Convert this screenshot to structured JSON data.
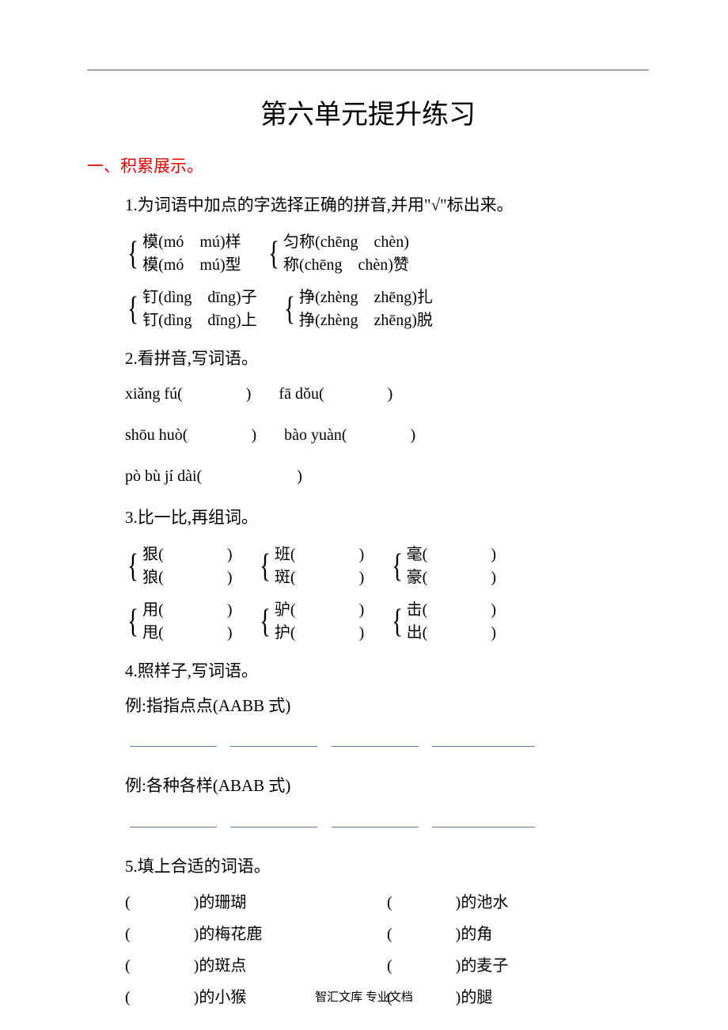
{
  "title": "第六单元提升练习",
  "section1": {
    "head": "一、积累展示。",
    "q1": {
      "prompt": "1.为词语中加点的字选择正确的拼音,并用\"√\"标出来。",
      "groups": [
        {
          "a": "模(mó　mú)样",
          "b": "模(mó　mú)型"
        },
        {
          "a": "匀称(chēng　chèn)",
          "b": "称(chēng　chèn)赞"
        },
        {
          "a": "钉(dìng　dīng)子",
          "b": "钉(dìng　dīng)上"
        },
        {
          "a": "挣(zhèng　zhēng)扎",
          "b": "挣(zhèng　zhēng)脱"
        }
      ]
    },
    "q2": {
      "prompt": "2.看拼音,写词语。",
      "items": [
        "xiǎng fú(　　　　)",
        "fā dǒu(　　　　)",
        "shōu huò(　　　　)",
        "bào yuàn(　　　　)",
        "pò bù jí dài(　　　　　　)"
      ]
    },
    "q3": {
      "prompt": "3.比一比,再组词。",
      "groups": [
        {
          "a": "狠(　　　　)",
          "b": "狼(　　　　)"
        },
        {
          "a": "班(　　　　)",
          "b": "斑(　　　　)"
        },
        {
          "a": "毫(　　　　)",
          "b": "豪(　　　　)"
        },
        {
          "a": "用(　　　　)",
          "b": "甩(　　　　)"
        },
        {
          "a": "驴(　　　　)",
          "b": "护(　　　　)"
        },
        {
          "a": "击(　　　　)",
          "b": "出(　　　　)"
        }
      ]
    },
    "q4": {
      "prompt": "4.照样子,写词语。",
      "ex1": "例:指指点点(AABB 式)",
      "ex2": "例:各种各样(ABAB 式)"
    },
    "q5": {
      "prompt": "5.填上合适的词语。",
      "items": [
        "(　　　　)的珊瑚",
        "(　　　　)的池水",
        "(　　　　)的梅花鹿",
        "(　　　　)的角",
        "(　　　　)的斑点",
        "(　　　　)的麦子",
        "(　　　　)的小猴",
        "(　　　　)的腿"
      ]
    }
  },
  "footer": "智汇文库 专业文档"
}
